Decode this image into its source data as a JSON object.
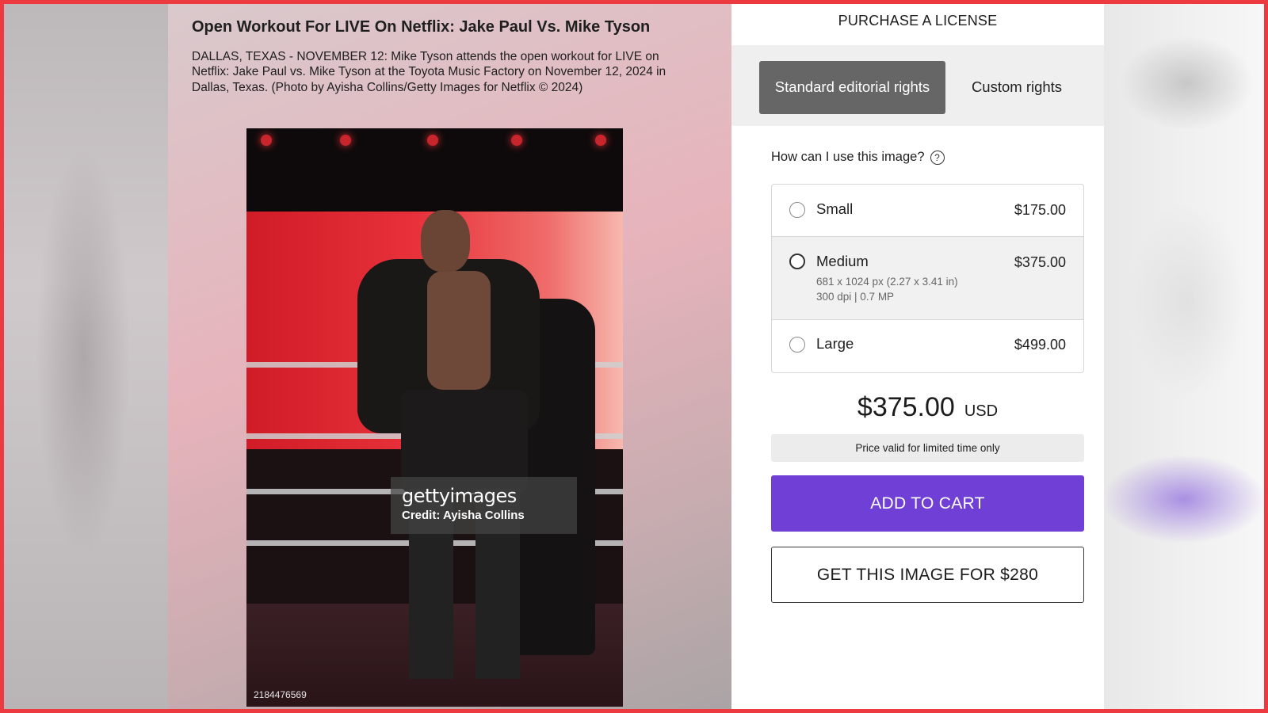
{
  "photo": {
    "title": "Open Workout For LIVE On Netflix: Jake Paul Vs. Mike Tyson",
    "caption": "DALLAS, TEXAS - NOVEMBER 12: Mike Tyson attends the open workout for LIVE on Netflix: Jake Paul vs. Mike Tyson at the Toyota Music Factory on November 12, 2024 in Dallas, Texas. (Photo by Ayisha Collins/Getty Images for Netflix © 2024)",
    "watermark_logo": "gettyimages",
    "watermark_credit": "Credit: Ayisha Collins",
    "image_id": "2184476569"
  },
  "purchase": {
    "heading": "PURCHASE A LICENSE",
    "tabs": [
      {
        "label": "Standard editorial rights",
        "active": true
      },
      {
        "label": "Custom rights",
        "active": false
      }
    ],
    "usage_question": "How can I use this image?",
    "help_icon": "?",
    "options": {
      "small": {
        "label": "Small",
        "price": "$175.00",
        "selected": false
      },
      "medium": {
        "label": "Medium",
        "price": "$375.00",
        "dimensions": "681 x 1024 px (2.27 x 3.41 in)",
        "resolution": "300 dpi | 0.7 MP",
        "selected": true
      },
      "large": {
        "label": "Large",
        "price": "$499.00",
        "selected": false
      }
    },
    "total_amount": "$375.00",
    "total_currency": "USD",
    "validity_note": "Price valid for limited time only",
    "add_to_cart_label": "ADD TO CART",
    "get_image_label": "GET THIS IMAGE FOR $280"
  },
  "colors": {
    "accent_purple": "#7040d6",
    "active_tab_gray": "#666666",
    "frame_red": "#ec3a40"
  }
}
